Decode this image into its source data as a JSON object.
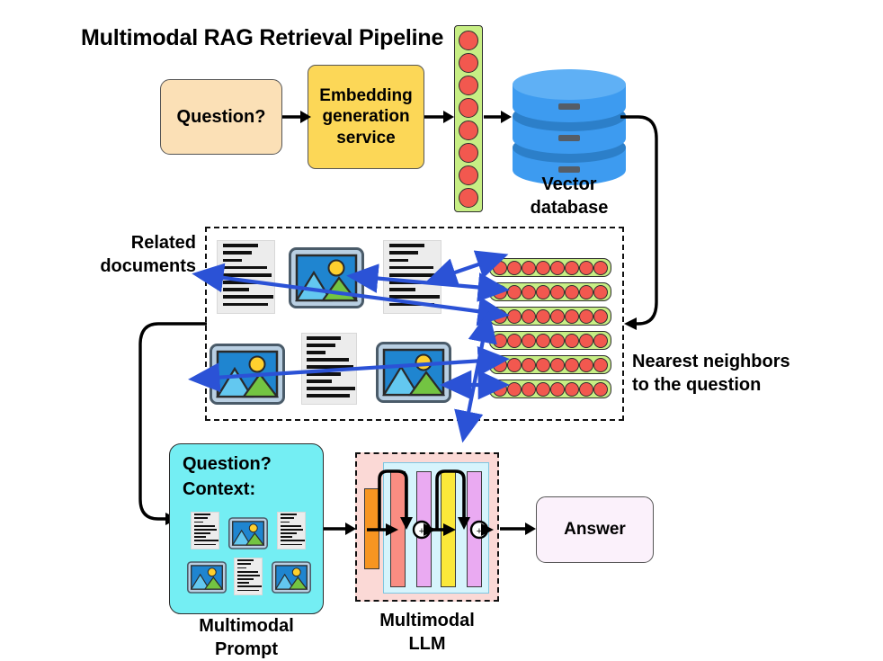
{
  "title": "Multimodal RAG Retrieval Pipeline",
  "pipeline": {
    "question_box": "Question?",
    "embedding_box": "Embedding\ngeneration\nservice",
    "embedding_box_lines": [
      "Embedding",
      "generation",
      "service"
    ],
    "vector_db_label_lines": [
      "Vector",
      "database"
    ],
    "query_vector": {
      "dots": 8,
      "orientation": "vertical",
      "dot_color": "#f2584f",
      "track_color": "#c7ee84"
    }
  },
  "retrieval": {
    "related_documents_label_lines": [
      "Related",
      "documents"
    ],
    "nearest_neighbors_label_lines": [
      "Nearest neighbors",
      "to the question"
    ],
    "neighbor_vectors": [
      {
        "dots": 8
      },
      {
        "dots": 8
      },
      {
        "dots": 8
      },
      {
        "dots": 8
      },
      {
        "dots": 8
      },
      {
        "dots": 8
      }
    ],
    "items_row1": [
      "document",
      "image",
      "document"
    ],
    "items_row2": [
      "image",
      "document",
      "image"
    ]
  },
  "prompt": {
    "line1": "Question?",
    "line2": "Context:",
    "caption_lines": [
      "Multimodal",
      "Prompt"
    ],
    "items_row1": [
      "document",
      "image",
      "document"
    ],
    "items_row2": [
      "image",
      "document",
      "image"
    ]
  },
  "llm": {
    "caption_lines": [
      "Multimodal",
      "LLM"
    ],
    "bars": [
      {
        "name": "input-bar",
        "color": "#f79521"
      },
      {
        "name": "layer-bar-1",
        "color": "#f98d82"
      },
      {
        "name": "layer-bar-2",
        "color": "#eaaaf2"
      },
      {
        "name": "layer-bar-3",
        "color": "#fbe83a"
      },
      {
        "name": "layer-bar-4",
        "color": "#eaaaf2"
      }
    ],
    "residual_op": "+"
  },
  "answer": {
    "label": "Answer"
  },
  "colors": {
    "question_fill": "#fbe0b6",
    "embedding_fill": "#fcd757",
    "answer_fill": "#fbf1fb",
    "prompt_fill": "#74eef3",
    "vector_track": "#c7ee84",
    "vector_dot": "#f2584f",
    "database_blue": "#3d9bf0",
    "arrow_blue": "#2b52d6",
    "arrow_black": "#000000"
  }
}
